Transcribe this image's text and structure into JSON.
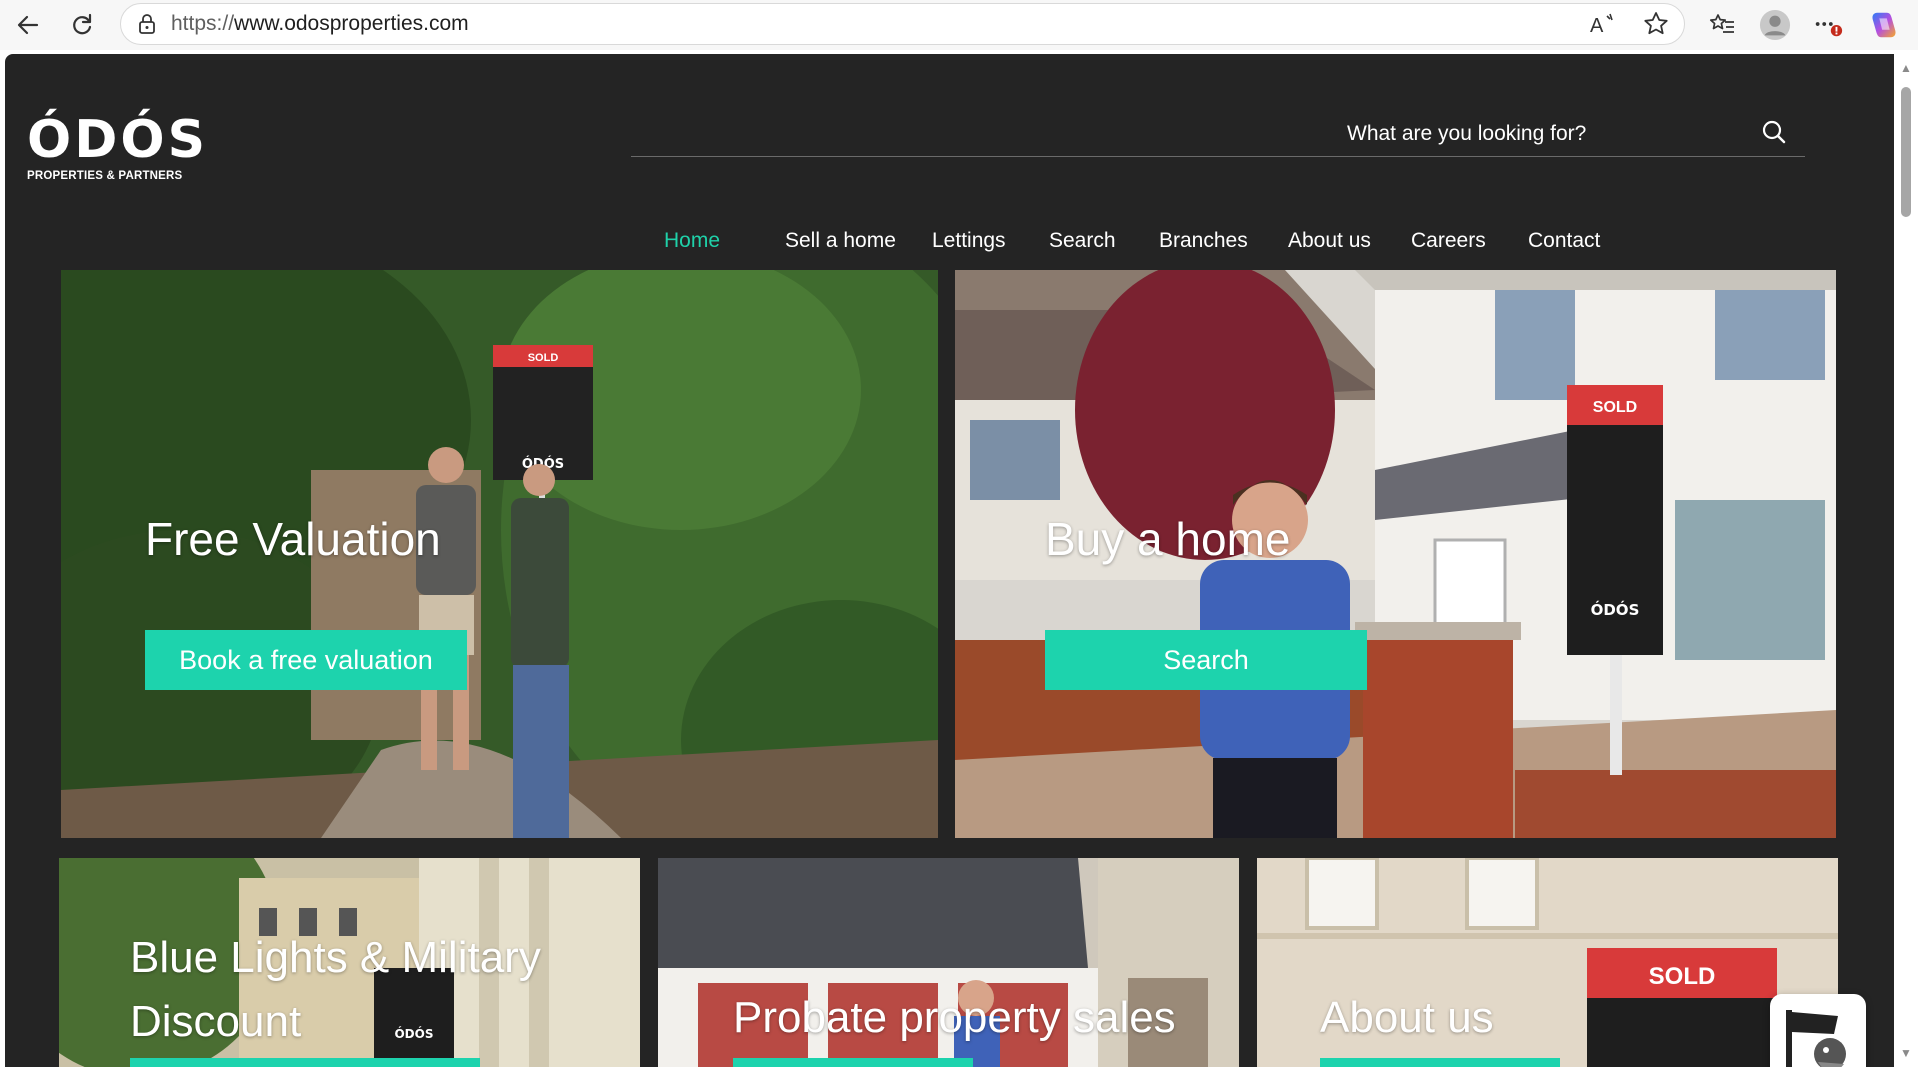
{
  "browser": {
    "url_scheme": "https://",
    "url_host": "www.odosproperties.com",
    "icons": [
      "back-arrow-icon",
      "refresh-icon",
      "lock-icon",
      "read-aloud-icon",
      "favorite-star-icon",
      "favorites-list-icon",
      "profile-avatar-icon",
      "more-options-icon",
      "copilot-icon"
    ]
  },
  "site": {
    "logo_mark": "ÓDÓS",
    "logo_sub": "PROPERTIES & PARTNERS",
    "search_placeholder": "What are you looking for?",
    "nav": [
      {
        "label": "Home",
        "active": true
      },
      {
        "label": "Sell a home",
        "active": false
      },
      {
        "label": "Lettings",
        "active": false
      },
      {
        "label": "Search",
        "active": false
      },
      {
        "label": "Branches",
        "active": false
      },
      {
        "label": "About us",
        "active": false
      },
      {
        "label": "Careers",
        "active": false
      },
      {
        "label": "Contact",
        "active": false
      }
    ]
  },
  "cards": {
    "valuation": {
      "title": "Free Valuation",
      "button": "Book a free valuation"
    },
    "buy": {
      "title": "Buy a home",
      "button": "Search"
    },
    "military": {
      "title_line1": "Blue Lights & Military",
      "title_line2": "Discount"
    },
    "probate": {
      "title": "Probate property sales"
    },
    "about": {
      "title": "About us"
    }
  },
  "signs": {
    "sold": "SOLD",
    "brand": "ÓDÓS"
  },
  "colors": {
    "accent": "#1dd3ad",
    "nav_active": "#1fd1a9",
    "background": "#242424"
  }
}
